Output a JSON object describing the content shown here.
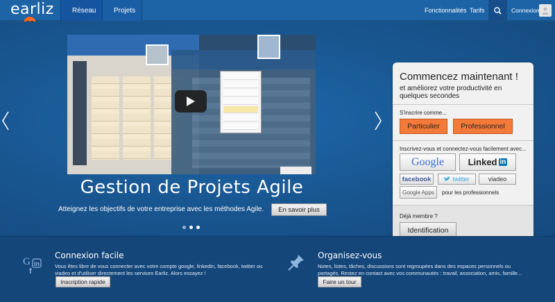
{
  "nav": {
    "logo": "earliz",
    "tab_reseau": "Réseau",
    "tab_projets": "Projets",
    "link_fonctionnalites": "Fonctionnalités",
    "link_tarifs": "Tarifs",
    "link_connexion": "Connexion"
  },
  "hero": {
    "title": "Gestion de Projets Agile",
    "subtitle": "Atteignez les objectifs de votre entreprise avec les méthodes Agile.",
    "cta": "En savoir plus",
    "slides": 3,
    "active_slide": 2
  },
  "signup": {
    "title": "Commencez maintenant !",
    "subtitle": "et améliorez votre productivité en quelques secondes",
    "signup_as": "S'inscrire comme...",
    "btn_particulier": "Particulier",
    "btn_professionnel": "Professionnel",
    "social_prompt": "Inscrivez-vous et connectez-vous facilement avec...",
    "google": "Google",
    "linkedin": "Linked",
    "linkedin_box": "in",
    "facebook": "facebook",
    "twitter": "twitter",
    "viadeo": "viadeo",
    "google_apps": "Google Apps",
    "pros_note": "pour les professionnels",
    "already_member": "Déjà membre ?",
    "btn_identification": "Identification"
  },
  "features": {
    "left": {
      "title": "Connexion facile",
      "text": "Vous êtes libre de vous connecter avec votre compte google, linkedin, facebook, twitter ou viadeo et d'utiliser directement les services Earliz. Alors essayez !",
      "button": "Inscription rapide"
    },
    "right": {
      "title": "Organisez-vous",
      "text": "Notes, listes, tâches, discussions sont regroupées dans des espaces personnels ou partagés. Restez en contact avec vos communautés : travail, association, amis, famille...",
      "button": "Faire un tour"
    }
  },
  "colors": {
    "nav_bg": "#1d64a6",
    "hero_bg": "#1b5486",
    "bottom_bg": "#14467a",
    "accent_orange": "#f47a3a"
  },
  "icons": [
    "network-icon",
    "bolt-icon",
    "search-icon",
    "user-avatar-icon",
    "chevron-left-icon",
    "chevron-right-icon",
    "play-icon",
    "social-login-icon",
    "pushpin-icon",
    "mascot-icon"
  ]
}
